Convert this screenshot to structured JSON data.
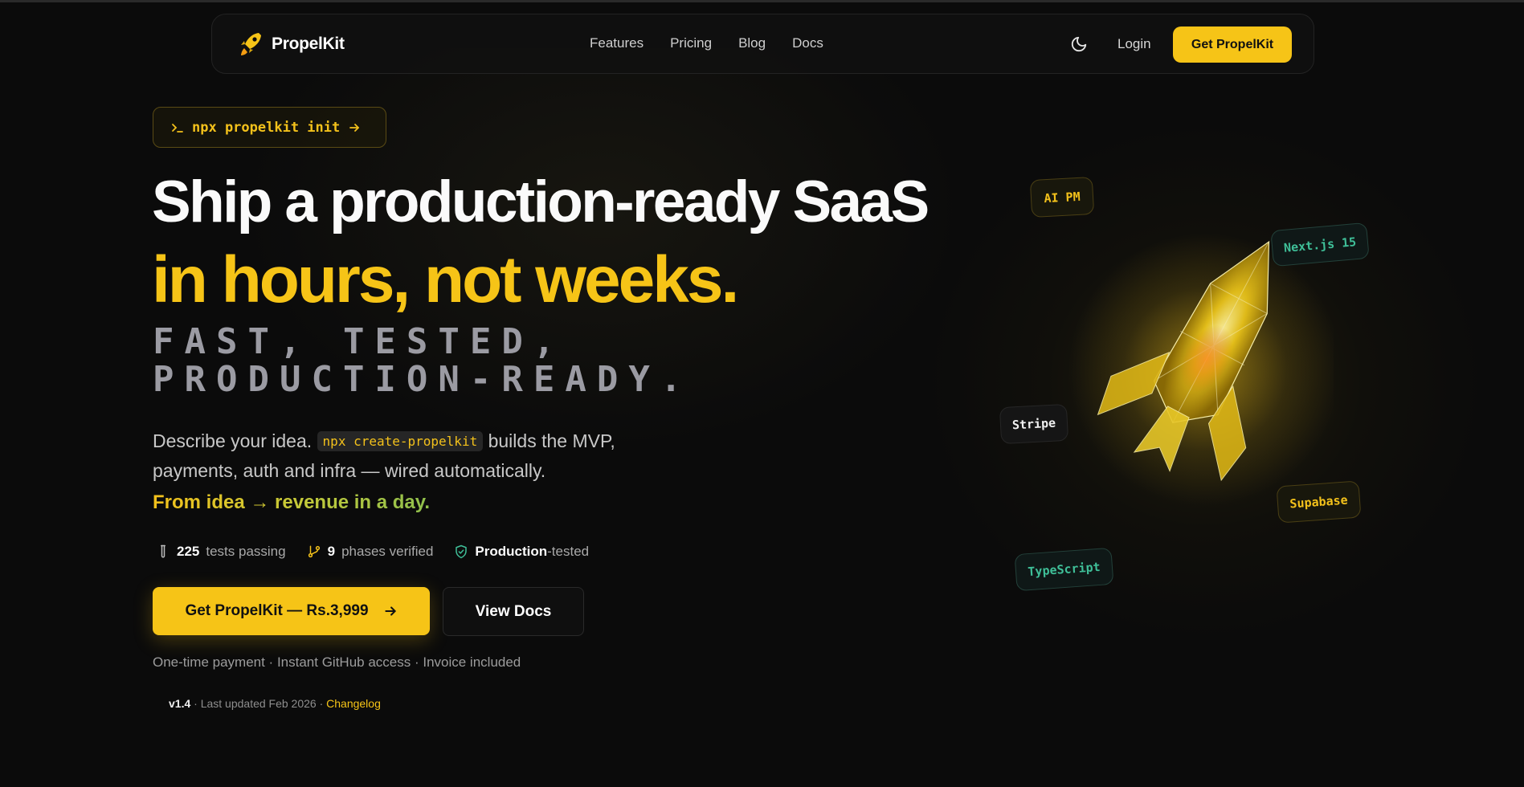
{
  "nav": {
    "brand": "PropelKit",
    "links": [
      "Features",
      "Pricing",
      "Blog",
      "Docs"
    ],
    "login": "Login",
    "cta": "Get PropelKit"
  },
  "hero": {
    "command_pill": "npx propelkit init",
    "headline_line1": "Ship a production-ready SaaS",
    "headline_line2": "in hours, not weeks.",
    "mono_subtitle": "FAST, TESTED, PRODUCTION-READY.",
    "description_before": "Describe your idea.",
    "description_code": "npx create-propelkit",
    "description_after": "builds the MVP, payments, auth and infra — wired automatically.",
    "tagline": "From idea → revenue in a day.",
    "stats": [
      {
        "value": "225",
        "label": "tests passing",
        "icon": "test-tube-icon"
      },
      {
        "value": "9",
        "label": "phases verified",
        "icon": "git-branch-icon"
      },
      {
        "value": "Production",
        "label": "-tested",
        "icon": "shield-check-icon"
      }
    ],
    "primary_cta": "Get PropelKit — Rs.3,999",
    "secondary_cta": "View Docs",
    "fineprint": "One-time payment · Instant GitHub access · Invoice included",
    "version": "v1.4",
    "updated": "· Last updated Feb 2026 ·",
    "changelog": "Changelog"
  },
  "tags": {
    "ai_pm": "AI PM",
    "nextjs": "Next.js 15",
    "stripe": "Stripe",
    "supabase": "Supabase",
    "typescript": "TypeScript"
  },
  "colors": {
    "accent": "#f6c417",
    "background": "#0b0b0b",
    "teal": "#3fbf98"
  }
}
